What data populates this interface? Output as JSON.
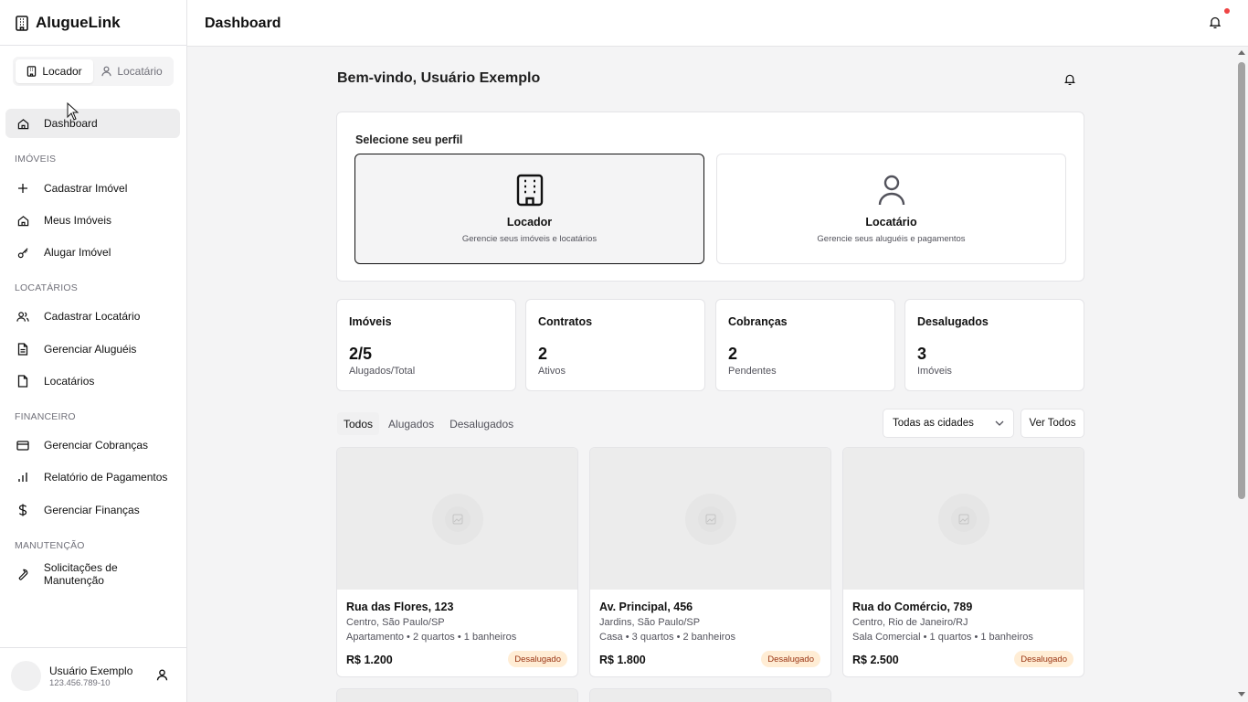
{
  "app": {
    "name": "AlugueLink"
  },
  "role_switch": {
    "owner_label": "Locador",
    "tenant_label": "Locatário",
    "active": "Locador"
  },
  "nav": {
    "dashboard": "Dashboard",
    "sections": {
      "properties": "IMÓVEIS",
      "tenants": "LOCATÁRIOS",
      "finance": "FINANCEIRO",
      "maintenance": "MANUTENÇÃO"
    },
    "items": {
      "register_property": "Cadastrar Imóvel",
      "my_properties": "Meus Imóveis",
      "rent_property": "Alugar Imóvel",
      "register_tenant": "Cadastrar Locatário",
      "manage_rentals": "Gerenciar Aluguéis",
      "tenants": "Locatários",
      "manage_charges": "Gerenciar Cobranças",
      "payment_report": "Relatório de Pagamentos",
      "manage_finances": "Gerenciar Finanças",
      "maintenance_requests": "Solicitações de Manutenção"
    }
  },
  "user": {
    "name": "Usuário Exemplo",
    "document": "123.456.789-10"
  },
  "header": {
    "title": "Dashboard",
    "has_notification": true
  },
  "welcome": "Bem-vindo, Usuário Exemplo",
  "profile": {
    "title": "Selecione seu perfil",
    "owner": {
      "title": "Locador",
      "subtitle": "Gerencie seus imóveis e locatários",
      "selected": true
    },
    "tenant": {
      "title": "Locatário",
      "subtitle": "Gerencie seus aluguéis e pagamentos",
      "selected": false
    }
  },
  "stats": [
    {
      "label": "Imóveis",
      "value": "2/5",
      "sub": "Alugados/Total"
    },
    {
      "label": "Contratos",
      "value": "2",
      "sub": "Ativos"
    },
    {
      "label": "Cobranças",
      "value": "2",
      "sub": "Pendentes"
    },
    {
      "label": "Desalugados",
      "value": "3",
      "sub": "Imóveis"
    }
  ],
  "filters": {
    "tabs": [
      "Todos",
      "Alugados",
      "Desalugados"
    ],
    "active_tab": "Todos",
    "city_select": "Todas as cidades",
    "see_all": "Ver Todos"
  },
  "properties": [
    {
      "address": "Rua das Flores, 123",
      "location": "Centro, São Paulo/SP",
      "details": "Apartamento • 2 quartos • 1 banheiros",
      "price": "R$ 1.200",
      "status": "Desalugado"
    },
    {
      "address": "Av. Principal, 456",
      "location": "Jardins, São Paulo/SP",
      "details": "Casa • 3 quartos • 2 banheiros",
      "price": "R$ 1.800",
      "status": "Desalugado"
    },
    {
      "address": "Rua do Comércio, 789",
      "location": "Centro, Rio de Janeiro/RJ",
      "details": "Sala Comercial • 1 quartos • 1 banheiros",
      "price": "R$ 2.500",
      "status": "Desalugado"
    }
  ],
  "colors": {
    "accent": "#111111",
    "badge_bg": "#ffedd5",
    "badge_text": "#9a3412",
    "notification_dot": "#ef4444"
  }
}
